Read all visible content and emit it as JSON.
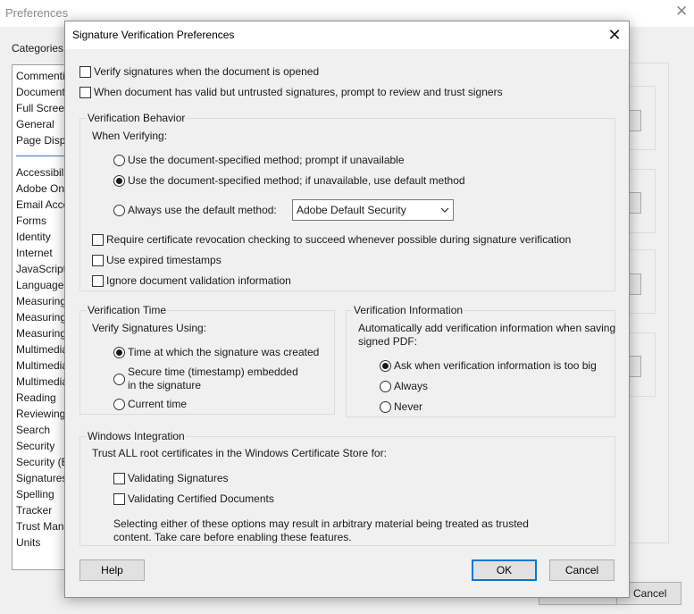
{
  "background_window": {
    "title": "Preferences",
    "close_glyph": "✕",
    "categories_label": "Categories:",
    "categories_top": [
      "Commenting",
      "Documents",
      "Full Screen",
      "General",
      "Page Display"
    ],
    "categories": [
      "Accessibility",
      "Adobe Online Services",
      "Email Accounts",
      "Forms",
      "Identity",
      "Internet",
      "JavaScript",
      "Language",
      "Measuring (2D)",
      "Measuring (3D)",
      "Measuring (Geo)",
      "Multimedia (legacy)",
      "Multimedia Trust (legacy)",
      "Multimedia & 3D",
      "Reading",
      "Reviewing",
      "Search",
      "Security",
      "Security (Enhanced)",
      "Signatures",
      "Spelling",
      "Tracker",
      "Trust Manager",
      "Units"
    ],
    "cancel_label": "Cancel"
  },
  "dialog": {
    "title": "Signature Verification Preferences",
    "close_glyph": "✕",
    "verify_on_open": {
      "label": "Verify signatures when the document is opened",
      "checked": false
    },
    "prompt_untrusted": {
      "label": "When document has valid but untrusted signatures, prompt to review and trust signers",
      "checked": false
    },
    "verification_behavior": {
      "group_label": "Verification Behavior",
      "when_verifying": "When Verifying:",
      "options": [
        {
          "label": "Use the document-specified method; prompt if unavailable",
          "selected": false
        },
        {
          "label": "Use the document-specified method; if unavailable, use default method",
          "selected": true
        },
        {
          "label": "Always use the default method:",
          "selected": false
        }
      ],
      "default_method_value": "Adobe Default Security",
      "checkboxes": [
        {
          "label": "Require certificate revocation checking to succeed whenever possible during signature verification",
          "checked": false
        },
        {
          "label": "Use expired timestamps",
          "checked": false
        },
        {
          "label": "Ignore document validation information",
          "checked": false
        }
      ]
    },
    "verification_time": {
      "group_label": "Verification Time",
      "subtitle": "Verify Signatures Using:",
      "options": [
        {
          "label": "Time at which the signature was created",
          "selected": true
        },
        {
          "label_line1": "Secure time (timestamp) embedded",
          "label_line2": "in the signature",
          "selected": false
        },
        {
          "label": "Current time",
          "selected": false
        }
      ]
    },
    "verification_information": {
      "group_label": "Verification Information",
      "description_line1": "Automatically add verification information when saving",
      "description_line2": "signed PDF:",
      "options": [
        {
          "label": "Ask when verification information is too big",
          "selected": true
        },
        {
          "label": "Always",
          "selected": false
        },
        {
          "label": "Never",
          "selected": false
        }
      ]
    },
    "windows_integration": {
      "group_label": "Windows Integration",
      "description": "Trust ALL root certificates in the Windows Certificate Store for:",
      "checkboxes": [
        {
          "label": "Validating Signatures",
          "checked": false
        },
        {
          "label": "Validating Certified Documents",
          "checked": false
        }
      ],
      "note": "Selecting either of these options may result in arbitrary material being treated as trusted content. Take care before enabling these features."
    },
    "help_label": "Help",
    "ok_label": "OK",
    "cancel_label": "Cancel"
  }
}
